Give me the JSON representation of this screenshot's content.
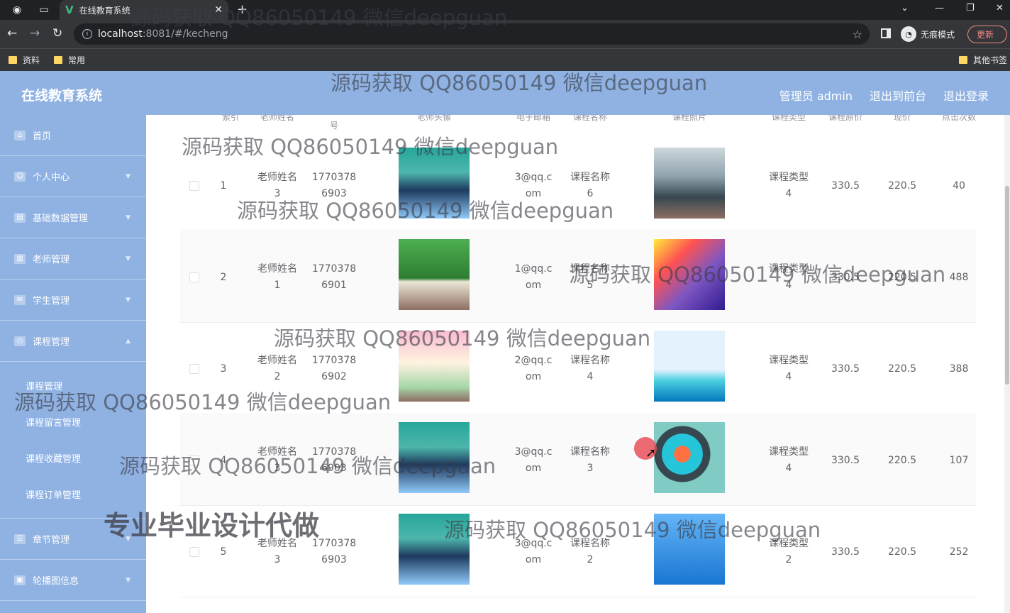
{
  "browser": {
    "tab_title": "在线教育系统",
    "url_host": "localhost",
    "url_path": ":8081/#/kecheng",
    "incognito_label": "无痕模式",
    "update_label": "更新",
    "bookmarks": [
      "资料",
      "常用"
    ],
    "other_bookmarks": "其他书签"
  },
  "app": {
    "brand": "在线教育系统",
    "top_links": [
      "管理员 admin",
      "退出到前台",
      "退出登录"
    ]
  },
  "sidebar": {
    "items": [
      {
        "label": "首页",
        "icon": "home-icon"
      },
      {
        "label": "个人中心",
        "icon": "user-icon"
      },
      {
        "label": "基础数据管理",
        "icon": "database-icon"
      },
      {
        "label": "老师管理",
        "icon": "chart-icon"
      },
      {
        "label": "学生管理",
        "icon": "student-icon"
      },
      {
        "label": "课程管理",
        "icon": "course-icon"
      }
    ],
    "sub_items": [
      "课程管理",
      "课程留言管理",
      "课程收藏管理",
      "课程订单管理"
    ],
    "bottom_items": [
      {
        "label": "章节管理",
        "icon": "list-icon"
      },
      {
        "label": "轮播图信息",
        "icon": "image-icon"
      }
    ]
  },
  "table": {
    "headers": [
      "索引",
      "老师姓名",
      "号",
      "老师头像",
      "电子邮箱",
      "课程名称",
      "课程照片",
      "课程类型",
      "课程原价",
      "现价",
      "点击次数"
    ],
    "rows": [
      {
        "idx": "1",
        "teacher_a": "老师姓名",
        "teacher_b": "3",
        "phone_a": "1770378",
        "phone_b": "6903",
        "email_a": "3@qq.c",
        "email_b": "om",
        "course_a": "课程名称",
        "course_b": "6",
        "type_a": "课程类型",
        "type_b": "4",
        "orig": "330.5",
        "price": "220.5",
        "clicks": "40"
      },
      {
        "idx": "2",
        "teacher_a": "老师姓名",
        "teacher_b": "1",
        "phone_a": "1770378",
        "phone_b": "6901",
        "email_a": "1@qq.c",
        "email_b": "om",
        "course_a": "课程名称",
        "course_b": "5",
        "type_a": "课程类型",
        "type_b": "4",
        "orig": "330.5",
        "price": "220.5",
        "clicks": "488"
      },
      {
        "idx": "3",
        "teacher_a": "老师姓名",
        "teacher_b": "2",
        "phone_a": "1770378",
        "phone_b": "6902",
        "email_a": "2@qq.c",
        "email_b": "om",
        "course_a": "课程名称",
        "course_b": "4",
        "type_a": "课程类型",
        "type_b": "4",
        "orig": "330.5",
        "price": "220.5",
        "clicks": "388"
      },
      {
        "idx": "4",
        "teacher_a": "老师姓名",
        "teacher_b": "3",
        "phone_a": "1770378",
        "phone_b": "6903",
        "email_a": "3@qq.c",
        "email_b": "om",
        "course_a": "课程名称",
        "course_b": "3",
        "type_a": "课程类型",
        "type_b": "4",
        "orig": "330.5",
        "price": "220.5",
        "clicks": "107"
      },
      {
        "idx": "5",
        "teacher_a": "老师姓名",
        "teacher_b": "3",
        "phone_a": "1770378",
        "phone_b": "6903",
        "email_a": "3@qq.c",
        "email_b": "om",
        "course_a": "课程名称",
        "course_b": "2",
        "type_a": "课程类型",
        "type_b": "2",
        "orig": "330.5",
        "price": "220.5",
        "clicks": "252"
      }
    ]
  },
  "watermark": {
    "text": "源码获取 QQ86050149 微信deepguan",
    "promo": "专业毕业设计代做"
  }
}
